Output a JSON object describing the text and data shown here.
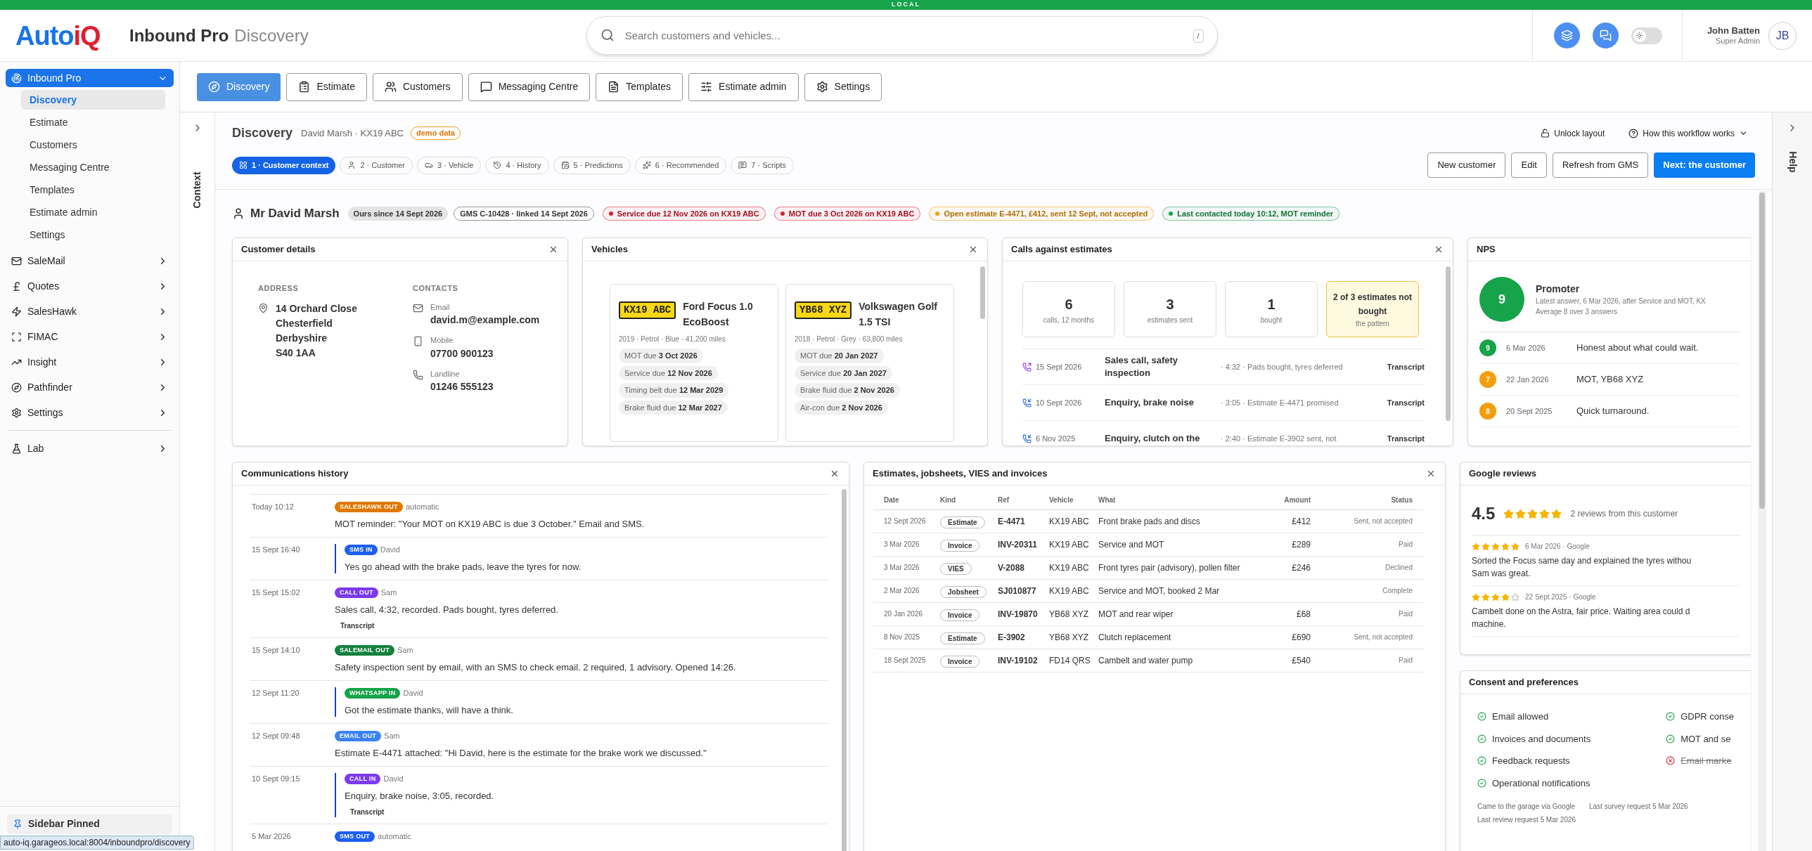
{
  "env_banner": "LOCAL",
  "header": {
    "logo": {
      "lead": "Auto",
      "tail": "iQ"
    },
    "app_title": "Inbound Pro",
    "page_title": "Discovery",
    "search": {
      "placeholder": "Search customers and vehicles...",
      "shortcut": "/"
    },
    "theme_toggle": {
      "on": false
    },
    "user": {
      "name": "John Batten",
      "role": "Super Admin",
      "initials": "JB"
    }
  },
  "sidebar": {
    "groups": [
      {
        "label": "Inbound Pro",
        "selected": true,
        "expanded": true,
        "children": [
          {
            "label": "Discovery",
            "selected": true
          },
          {
            "label": "Estimate",
            "selected": false
          },
          {
            "label": "Customers",
            "selected": false
          },
          {
            "label": "Messaging Centre",
            "selected": false
          },
          {
            "label": "Templates",
            "selected": false
          },
          {
            "label": "Estimate admin",
            "selected": false
          },
          {
            "label": "Settings",
            "selected": false
          }
        ]
      },
      {
        "label": "SaleMail",
        "selected": false,
        "expanded": false
      },
      {
        "label": "Quotes",
        "selected": false,
        "expanded": false
      },
      {
        "label": "SalesHawk",
        "selected": false,
        "expanded": false
      },
      {
        "label": "FIMAC",
        "selected": false,
        "expanded": false
      },
      {
        "label": "Insight",
        "selected": false,
        "expanded": false
      },
      {
        "label": "Pathfinder",
        "selected": false,
        "expanded": false
      },
      {
        "label": "Settings",
        "selected": false,
        "expanded": false
      }
    ],
    "tools": [
      {
        "label": "Lab",
        "selected": false,
        "expanded": false
      }
    ],
    "footer": "Sidebar Pinned"
  },
  "browser_status": "auto-iq.garageos.local:8004/inboundpro/discovery",
  "top_tabs": [
    {
      "label": "Discovery",
      "selected": true
    },
    {
      "label": "Estimate",
      "selected": false
    },
    {
      "label": "Customers",
      "selected": false
    },
    {
      "label": "Messaging Centre",
      "selected": false
    },
    {
      "label": "Templates",
      "selected": false
    },
    {
      "label": "Estimate admin",
      "selected": false
    },
    {
      "label": "Settings",
      "selected": false
    }
  ],
  "context_rail": {
    "label": "Context"
  },
  "help_rail": {
    "label": "Help"
  },
  "page": {
    "title": "Discovery",
    "subtitle": "David Marsh · KX19 ABC",
    "badge": "demo data",
    "links": [
      "Unlock layout",
      "How this workflow works"
    ],
    "steps": [
      {
        "label": "1 · Customer context",
        "selected": true
      },
      {
        "label": "2 · Customer",
        "selected": false
      },
      {
        "label": "3 · Vehicle",
        "selected": false
      },
      {
        "label": "4 · History",
        "selected": false
      },
      {
        "label": "5 · Predictions",
        "selected": false
      },
      {
        "label": "6 · Recommended",
        "selected": false
      },
      {
        "label": "7 · Scripts",
        "selected": false
      }
    ],
    "buttons": [
      {
        "label": "New customer",
        "kind": "secondary"
      },
      {
        "label": "Edit",
        "kind": "secondary"
      },
      {
        "label": "Refresh from GMS",
        "kind": "secondary"
      },
      {
        "label": "Next: the customer",
        "kind": "primary"
      }
    ]
  },
  "customer": {
    "name": "Mr David Marsh",
    "tags": [
      {
        "text": "Ours since 14 Sept 2026",
        "kind": "filled"
      },
      {
        "text": "GMS C-10428 · linked 14 Sept 2026",
        "kind": "outline"
      },
      {
        "text": "Service due 12 Nov 2026 on KX19 ABC",
        "kind": "alert",
        "color": "#e11d2e"
      },
      {
        "text": "MOT due 3 Oct 2026 on KX19 ABC",
        "kind": "alert",
        "color": "#e11d2e"
      },
      {
        "text": "Open estimate E-4471, £412, sent 12 Sept, not accepted",
        "kind": "alert",
        "color": "#f59e0b"
      },
      {
        "text": "Last contacted today 10:12, MOT reminder",
        "kind": "alert",
        "color": "#16a34a"
      }
    ]
  },
  "customer_details": {
    "title": "Customer details",
    "closable": true,
    "address_heading": "ADDRESS",
    "address": [
      "14 Orchard Close",
      "Chesterfield",
      "Derbyshire",
      "S40 1AA"
    ],
    "contacts_heading": "CONTACTS",
    "contacts": [
      {
        "kind": "email",
        "label": "Email",
        "value": "david.m@example.com"
      },
      {
        "kind": "mobile",
        "label": "Mobile",
        "value": "07700 900123"
      },
      {
        "kind": "landline",
        "label": "Landline",
        "value": "01246 555123"
      }
    ]
  },
  "vehicles": {
    "title": "Vehicles",
    "closable": true,
    "items": [
      {
        "plate": "KX19 ABC",
        "name": "Ford Focus 1.0 EcoBoost",
        "meta": "2019 · Petrol · Blue · 41,200 miles",
        "dues": [
          {
            "label": "MOT due",
            "date": "3 Oct 2026"
          },
          {
            "label": "Service due",
            "date": "12 Nov 2026"
          },
          {
            "label": "Timing belt due",
            "date": "12 Mar 2029"
          },
          {
            "label": "Brake fluid due",
            "date": "12 Mar 2027"
          }
        ]
      },
      {
        "plate": "YB68 XYZ",
        "name": "Volkswagen Golf 1.5 TSI",
        "meta": "2018 · Petrol · Grey · 63,800 miles",
        "dues": [
          {
            "label": "MOT due",
            "date": "20 Jan 2027"
          },
          {
            "label": "Service due",
            "date": "20 Jan 2027"
          },
          {
            "label": "Brake fluid due",
            "date": "2 Nov 2026"
          },
          {
            "label": "Air-con due",
            "date": "2 Nov 2026"
          }
        ]
      }
    ]
  },
  "calls": {
    "title": "Calls against estimates",
    "closable": true,
    "stats": [
      {
        "kind": "stat",
        "value": "6",
        "label": "calls, 12 months"
      },
      {
        "kind": "stat",
        "value": "3",
        "label": "estimates sent"
      },
      {
        "kind": "stat",
        "value": "1",
        "label": "bought"
      },
      {
        "kind": "highlight",
        "value": "2 of 3 estimates not bought",
        "label": "the pattern"
      }
    ],
    "items": [
      {
        "incoming": false,
        "date": "15 Sept 2026",
        "title": "Sales call, safety inspection",
        "detail": "· 4:32 · Pads bought, tyres deferred",
        "action": "Transcript"
      },
      {
        "incoming": true,
        "date": "10 Sept 2026",
        "title": "Enquiry, brake noise",
        "detail": "· 3:05 · Estimate E-4471 promised",
        "action": "Transcript"
      },
      {
        "incoming": true,
        "date": "6 Nov 2025",
        "title": "Enquiry, clutch on the",
        "detail": "· 2:40 · Estimate E-3902 sent, not",
        "action": "Transcript"
      }
    ]
  },
  "nps": {
    "title": "NPS",
    "score": "9",
    "color": "#16a34a",
    "category": "Promoter",
    "latest": "Latest answer, 6 Mar 2026, after Service and MOT, KX",
    "average": "Average 8 over 3 answers",
    "responses": [
      {
        "score": "9",
        "color": "#16a34a",
        "date": "6 Mar 2026",
        "text": "Honest about what could wait."
      },
      {
        "score": "7",
        "color": "#f59e0b",
        "date": "22 Jan 2026",
        "text": "MOT, YB68 XYZ"
      },
      {
        "score": "8",
        "color": "#f59e0b",
        "date": "20 Sept 2025",
        "text": "Quick turnaround."
      }
    ]
  },
  "comms": {
    "title": "Communications history",
    "closable": true,
    "entries": [
      {
        "time": "Today 10:12",
        "tag": "SALESHAWK OUT",
        "color": "#e07800",
        "who": "automatic",
        "incoming": false,
        "text": "MOT reminder: \"Your MOT on KX19 ABC is due 3 October.\" Email and SMS."
      },
      {
        "time": "15 Sept 16:40",
        "tag": "SMS IN",
        "color": "#1d5ff2",
        "who": "David",
        "incoming": true,
        "text": "Yes go ahead with the brake pads, leave the tyres for now."
      },
      {
        "time": "15 Sept 15:02",
        "tag": "CALL OUT",
        "color": "#7c3aed",
        "who": "Sam",
        "incoming": false,
        "text": "Sales call, 4:32, recorded. Pads bought, tyres deferred.",
        "action": "Transcript"
      },
      {
        "time": "15 Sept 14:10",
        "tag": "SALEMAIL OUT",
        "color": "#15803d",
        "who": "Sam",
        "incoming": false,
        "text": "Safety inspection sent by email, with an SMS to check email. 2 required, 1 advisory. Opened 14:26."
      },
      {
        "time": "12 Sept 11:20",
        "tag": "WHATSAPP IN",
        "color": "#16a34a",
        "who": "David",
        "incoming": true,
        "text": "Got the estimate thanks, will have a think."
      },
      {
        "time": "12 Sept 09:48",
        "tag": "EMAIL OUT",
        "color": "#3b82f6",
        "who": "Sam",
        "incoming": false,
        "text": "Estimate E-4471 attached: \"Hi David, here is the estimate for the brake work we discussed.\""
      },
      {
        "time": "10 Sept 09:15",
        "tag": "CALL IN",
        "color": "#7c3aed",
        "who": "David",
        "incoming": true,
        "text": "Enquiry, brake noise, 3:05, recorded.",
        "action": "Transcript"
      },
      {
        "time": "5 Mar 2026",
        "tag": "SMS OUT",
        "color": "#1d5ff2",
        "who": "automatic",
        "incoming": false
      }
    ]
  },
  "documents": {
    "title": "Estimates, jobsheets, VIES and invoices",
    "closable": true,
    "columns": [
      "Date",
      "Kind",
      "Ref",
      "Vehicle",
      "What",
      "Amount",
      "Status"
    ],
    "rows": [
      {
        "date": "12 Sept 2026",
        "kind": "Estimate",
        "ref": "E-4471",
        "vehicle": "KX19 ABC",
        "what": "Front brake pads and discs",
        "amount": "£412",
        "status": "Sent, not accepted"
      },
      {
        "date": "3 Mar 2026",
        "kind": "Invoice",
        "ref": "INV-20311",
        "vehicle": "KX19 ABC",
        "what": "Service and MOT",
        "amount": "£289",
        "status": "Paid"
      },
      {
        "date": "3 Mar 2026",
        "kind": "VIES",
        "ref": "V-2088",
        "vehicle": "KX19 ABC",
        "what": "Front tyres pair (advisory), pollen filter",
        "amount": "£246",
        "status": "Declined"
      },
      {
        "date": "2 Mar 2026",
        "kind": "Jobsheet",
        "ref": "SJ010877",
        "vehicle": "KX19 ABC",
        "what": "Service and MOT, booked 2 Mar",
        "status": "Complete"
      },
      {
        "date": "20 Jan 2026",
        "kind": "Invoice",
        "ref": "INV-19870",
        "vehicle": "YB68 XYZ",
        "what": "MOT and rear wiper",
        "amount": "£68",
        "status": "Paid"
      },
      {
        "date": "8 Nov 2025",
        "kind": "Estimate",
        "ref": "E-3902",
        "vehicle": "YB68 XYZ",
        "what": "Clutch replacement",
        "amount": "£690",
        "status": "Sent, not accepted"
      },
      {
        "date": "18 Sept 2025",
        "kind": "Invoice",
        "ref": "INV-19102",
        "vehicle": "FD14 QRS",
        "what": "Cambelt and water pump",
        "amount": "£540",
        "status": "Paid"
      }
    ]
  },
  "reviews": {
    "title": "Google reviews",
    "rating": "4.5",
    "stars": 5,
    "summary": "2 reviews from this customer",
    "items": [
      {
        "stars": 5,
        "meta": "6 Mar 2026 · Google",
        "lines": [
          "Sorted the Focus same day and explained the tyres withou",
          "Sam was great."
        ]
      },
      {
        "stars": 4,
        "meta": "22 Sept 2025 · Google",
        "lines": [
          "Cambelt done on the Astra, fair price. Waiting area could d",
          "machine."
        ]
      }
    ]
  },
  "consent": {
    "title": "Consent and preferences",
    "items": [
      {
        "label": "Email allowed",
        "allowed": true
      },
      {
        "label": "GDPR conse",
        "allowed": true
      },
      {
        "label": "Invoices and documents",
        "allowed": true
      },
      {
        "label": "MOT and se",
        "allowed": true
      },
      {
        "label": "Feedback requests",
        "allowed": true
      },
      {
        "label": "Email marke",
        "allowed": false
      },
      {
        "label": "Operational notifications",
        "allowed": true
      }
    ],
    "notes": [
      "Came to the garage via Google",
      "Last survey request 5 Mar 2026",
      "Last review request 5 Mar 2026"
    ]
  }
}
